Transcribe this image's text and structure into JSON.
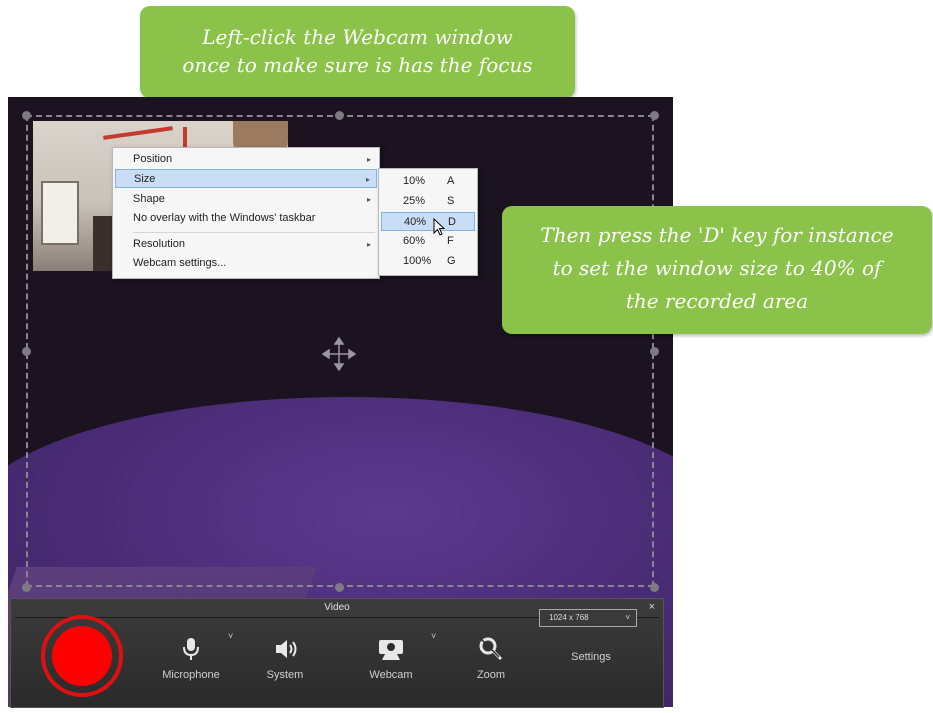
{
  "callouts": {
    "top_line1": "Left-click the Webcam window",
    "top_line2": "once to make sure is has the focus",
    "right_line1": "Then press the 'D' key for instance",
    "right_line2": "to set the window size to 40% of",
    "right_line3": "the recorded area"
  },
  "context_menu": {
    "items": [
      {
        "label": "Position",
        "has_submenu": true
      },
      {
        "label": "Size",
        "has_submenu": true
      },
      {
        "label": "Shape",
        "has_submenu": true
      },
      {
        "label": "No overlay with the Windows' taskbar",
        "has_submenu": false
      },
      {
        "label": "Resolution",
        "has_submenu": true
      },
      {
        "label": "Webcam settings...",
        "has_submenu": false
      }
    ],
    "submenu_arrow": "▸"
  },
  "size_submenu": {
    "items": [
      {
        "percent": "10%",
        "key": "A"
      },
      {
        "percent": "25%",
        "key": "S"
      },
      {
        "percent": "40%",
        "key": "D"
      },
      {
        "percent": "60%",
        "key": "F"
      },
      {
        "percent": "100%",
        "key": "G"
      }
    ],
    "selected": "40%"
  },
  "recorder": {
    "title": "Video",
    "close": "×",
    "tools": {
      "microphone": "Microphone",
      "system": "System",
      "webcam": "Webcam",
      "zoom": "Zoom",
      "settings": "Settings"
    },
    "caret": "˅",
    "resolution_value": "1024 x 768",
    "record_color": "#ff0000"
  },
  "icons": {
    "record": "record-button-icon",
    "microphone": "microphone-icon",
    "system": "speaker-icon",
    "webcam": "webcam-icon",
    "zoom": "zoom-icon",
    "move": "move-cross-icon",
    "cursor": "mouse-pointer-icon"
  },
  "colors": {
    "callout": "#8bc34a",
    "menu_highlight": "#c9def5",
    "screen_bg": "#1b1320",
    "purple": "#4b2d78"
  }
}
